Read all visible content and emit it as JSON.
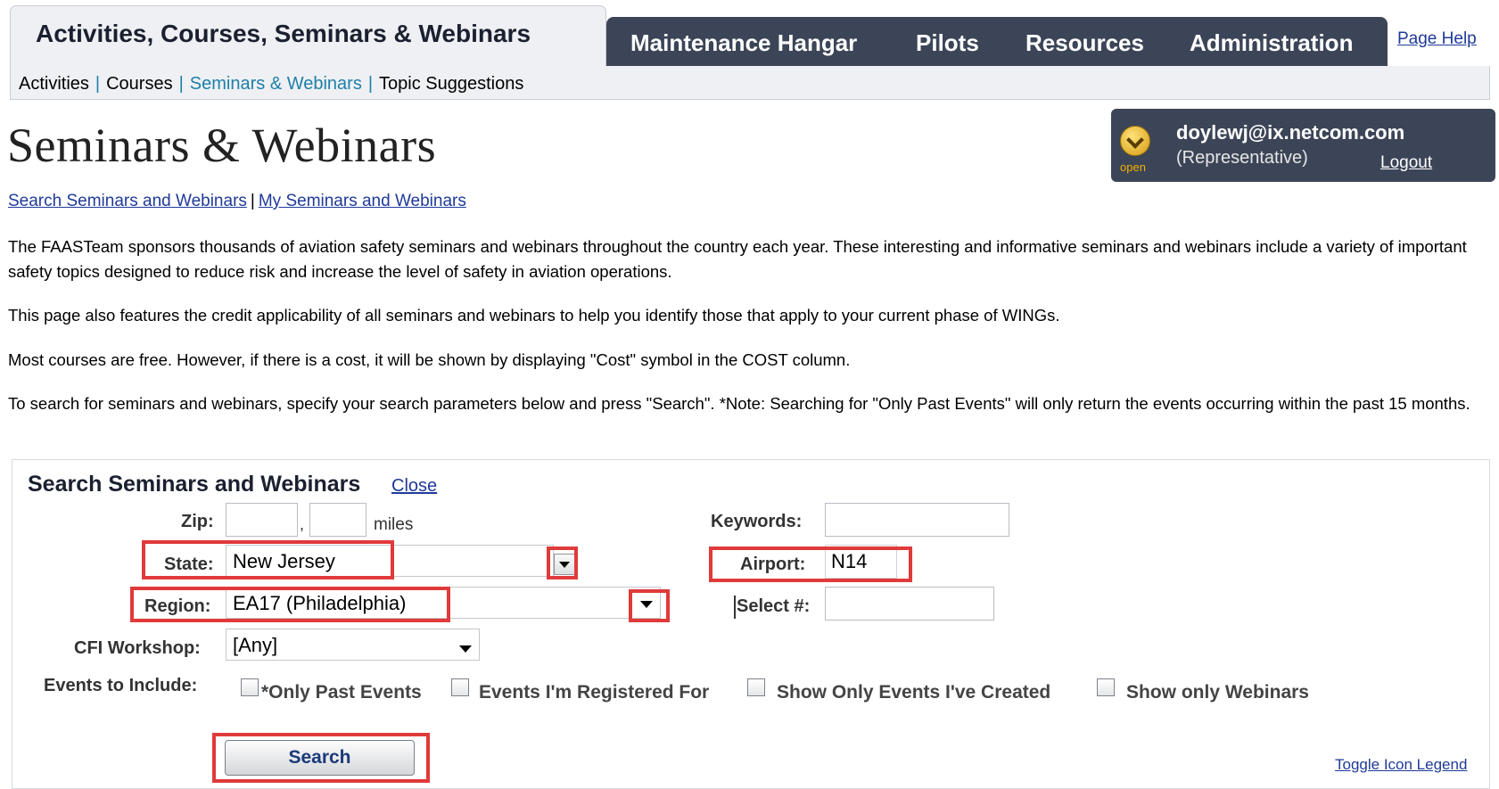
{
  "nav": {
    "active_tab": "Activities, Courses, Seminars & Webinars",
    "tabs": [
      "Maintenance Hangar",
      "Pilots",
      "Resources",
      "Administration"
    ],
    "page_help": "Page Help"
  },
  "subnav": {
    "items": [
      "Activities",
      "Courses",
      "Seminars & Webinars",
      "Topic Suggestions"
    ],
    "active": "Seminars & Webinars"
  },
  "header": {
    "title": "Seminars & Webinars"
  },
  "user": {
    "email": "doylewj@ix.netcom.com",
    "role": "(Representative)",
    "logout": "Logout",
    "status": "open"
  },
  "links": {
    "search": "Search Seminars and Webinars",
    "separator": "|",
    "mine": "My Seminars and Webinars"
  },
  "paragraphs": [
    "The FAASTeam sponsors thousands of aviation safety seminars and webinars throughout the country each year. These interesting and informative seminars and webinars include a variety of important safety topics designed to reduce risk and increase the level of safety in aviation operations.",
    "This page also features the credit applicability of all seminars and webinars to help you identify those that apply to your current phase of WINGs.",
    "Most courses are free. However, if there is a cost, it will be shown by displaying \"Cost\" symbol in the COST column.",
    "To search for seminars and webinars, specify your search parameters below and press \"Search\". *Note: Searching for \"Only Past Events\" will only return the events occurring within the past 15 months."
  ],
  "search": {
    "title": "Search Seminars and Webinars",
    "close": "Close",
    "zip_label": "Zip:",
    "zip_value": "",
    "zip_sep": ",",
    "miles_value": "",
    "miles_label": "miles",
    "keywords_label": "Keywords:",
    "keywords_value": "",
    "state_label": "State:",
    "state_value": "New Jersey",
    "airport_label": "Airport:",
    "airport_value": "N14",
    "region_label": "Region:",
    "region_value": "EA17 (Philadelphia)",
    "select_label": "Select #:",
    "select_value": "",
    "cfi_label": "CFI Workshop:",
    "cfi_value": "[Any]",
    "events_label": "Events to Include:",
    "events": [
      "*Only Past Events",
      "Events I'm Registered For",
      "Show Only Events I've Created",
      "Show only Webinars"
    ],
    "search_button": "Search",
    "toggle_legend": "Toggle Icon Legend"
  },
  "colors": {
    "nav_dark": "#3c4557",
    "link": "#1f3a99",
    "subnav_active": "#1e7fa8",
    "highlight": "#e03a3a"
  }
}
